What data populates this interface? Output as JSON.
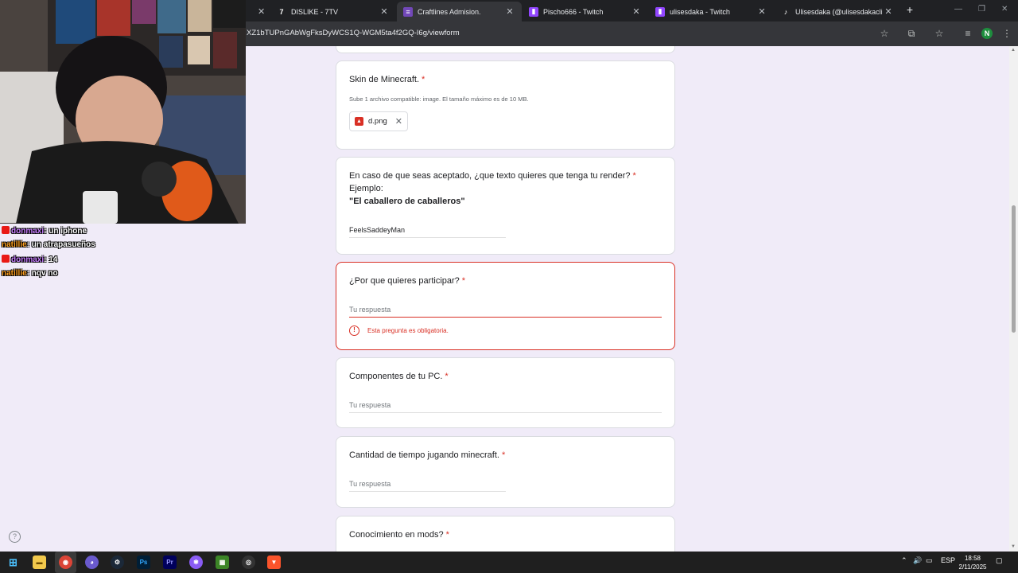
{
  "browser": {
    "tabs": [
      {
        "label": "DISLIKE - 7TV",
        "icon": "7tv-icon"
      },
      {
        "label": "Craftlines Admision.",
        "icon": "forms-icon",
        "active": true
      },
      {
        "label": "Pischo666 - Twitch",
        "icon": "twitch-icon"
      },
      {
        "label": "ulisesdaka - Twitch",
        "icon": "twitch-icon"
      },
      {
        "label": "Ulisesdaka (@ulisesdakaclips) |",
        "icon": "tiktok-icon"
      }
    ],
    "url": "XZ1bTUPnGAbWgFksDyWCS1Q-WGM5ta4f2GQ-I6g/viewform",
    "profile_initial": "N"
  },
  "form": {
    "skin": {
      "title": "Skin de Minecraft.",
      "required_mark": "*",
      "hint": "Sube 1 archivo compatible: image. El tamaño máximo es de 10 MB.",
      "file_name": "d.png"
    },
    "render_text": {
      "title": "En caso de que seas aceptado, ¿que texto quieres que tenga tu render?",
      "required_mark": "*",
      "example_label": "Ejemplo:",
      "example_value": "\"El caballero de caballeros\"",
      "answer": "FeelsSaddeyMan"
    },
    "why": {
      "title": "¿Por que quieres participar?",
      "required_mark": "*",
      "placeholder": "Tu respuesta",
      "error": "Esta pregunta es obligatoria."
    },
    "pc": {
      "title": "Componentes de tu PC.",
      "required_mark": "*",
      "placeholder": "Tu respuesta"
    },
    "playtime": {
      "title": "Cantidad de tiempo jugando minecraft.",
      "required_mark": "*",
      "placeholder": "Tu respuesta"
    },
    "mods": {
      "title": "Conocimiento en mods?",
      "required_mark": "*"
    }
  },
  "chat": [
    {
      "user": "donmaxi",
      "message": "un iphone",
      "color": "#c77dff",
      "badge": true
    },
    {
      "user": "natillie",
      "message": "un atrapasueños",
      "color": "#ff9f1c",
      "badge": false
    },
    {
      "user": "donmaxi",
      "message": "14",
      "color": "#c77dff",
      "badge": true
    },
    {
      "user": "natillie",
      "message": "nqv no",
      "color": "#ff9f1c",
      "badge": false
    }
  ],
  "taskbar": {
    "language": "ESP",
    "time": "18:58",
    "date": "2/11/2025"
  },
  "colors": {
    "form_background": "#f0ebf8",
    "error": "#d93025",
    "browser_dark": "#202124"
  }
}
